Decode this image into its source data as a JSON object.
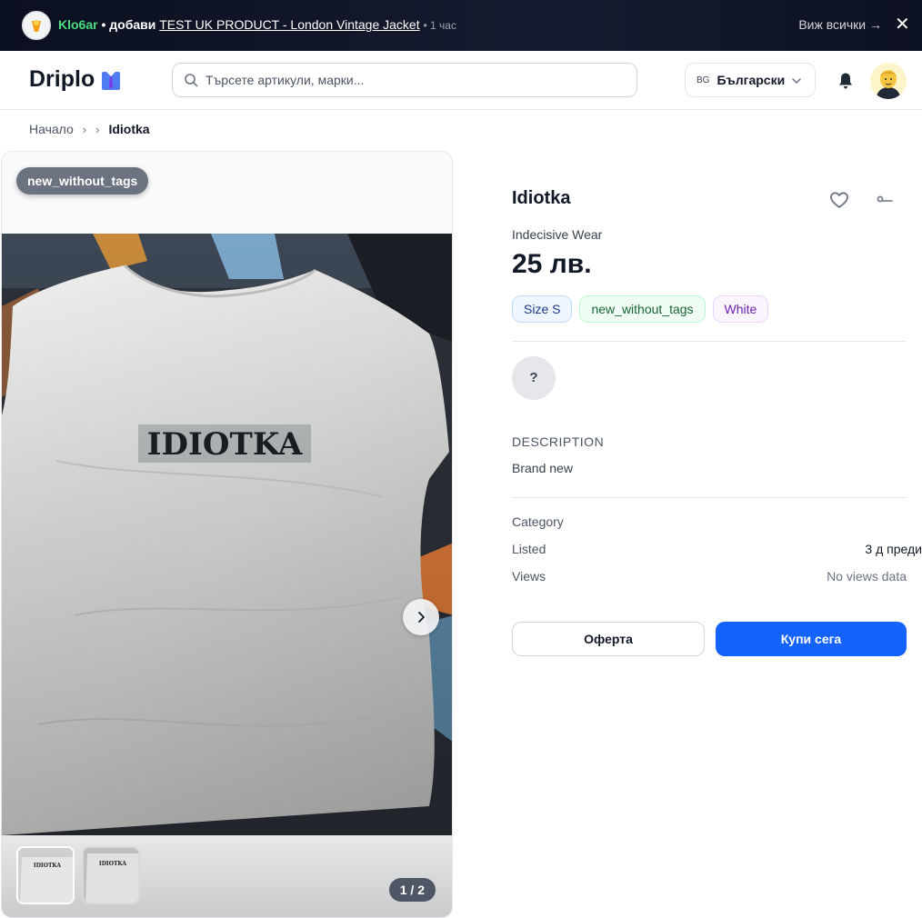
{
  "notification": {
    "user": "Klo6ar",
    "action": "• добави",
    "product": "TEST UK PRODUCT - London Vintage Jacket",
    "time": "• 1 час",
    "see_all": "Виж всички →",
    "close_glyph": "✕"
  },
  "header": {
    "logo": "Driplo",
    "search_placeholder": "Търсете артикули, марки...",
    "lang_code": "BG",
    "lang_name": "Български"
  },
  "breadcrumb": {
    "home": "Начало",
    "separator": "›",
    "current": "Idiotka"
  },
  "gallery": {
    "condition_badge": "new_without_tags",
    "print_text": "IDIOTKA",
    "counter": "1 / 2",
    "thumbnail_count": 2
  },
  "product": {
    "title": "Idiotka",
    "brand": "Indecisive Wear",
    "price": "25 лв.",
    "tags": {
      "size": "Size S",
      "condition": "new_without_tags",
      "color": "White"
    },
    "seller_initial": "?",
    "description_heading": "DESCRIPTION",
    "description": "Brand new",
    "meta": {
      "category_label": "Category",
      "category_value": "",
      "listed_label": "Listed",
      "listed_value": "3 д преди",
      "views_label": "Views",
      "views_value": "No views data"
    },
    "offer_button": "Оферта",
    "buy_button": "Купи сега"
  },
  "colors": {
    "accent": "#1463ff",
    "notification_user": "#4ade80",
    "condition_badge": "#6b7280"
  }
}
